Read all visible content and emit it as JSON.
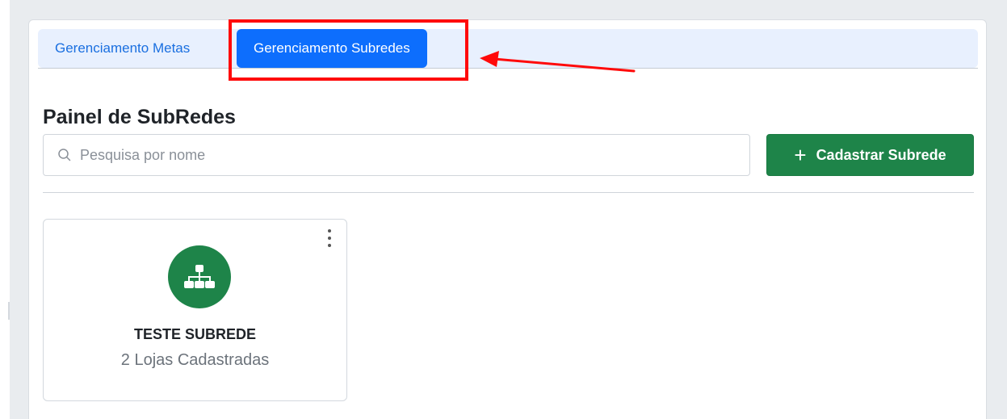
{
  "tabs": [
    {
      "label": "Gerenciamento Metas",
      "active": false
    },
    {
      "label": "Gerenciamento Subredes",
      "active": true
    }
  ],
  "page_title": "Painel de SubRedes",
  "search": {
    "placeholder": "Pesquisa por nome",
    "value": ""
  },
  "add_button": {
    "label": "Cadastrar Subrede",
    "icon": "plus-icon"
  },
  "cards": [
    {
      "name": "TESTE SUBREDE",
      "subtitle": "2 Lojas Cadastradas",
      "icon": "sitemap-icon"
    }
  ],
  "colors": {
    "active_tab": "#0d6efd",
    "tab_text": "#1a6fe0",
    "primary_green": "#1e8449",
    "annotation_red": "#ff0a0a"
  }
}
